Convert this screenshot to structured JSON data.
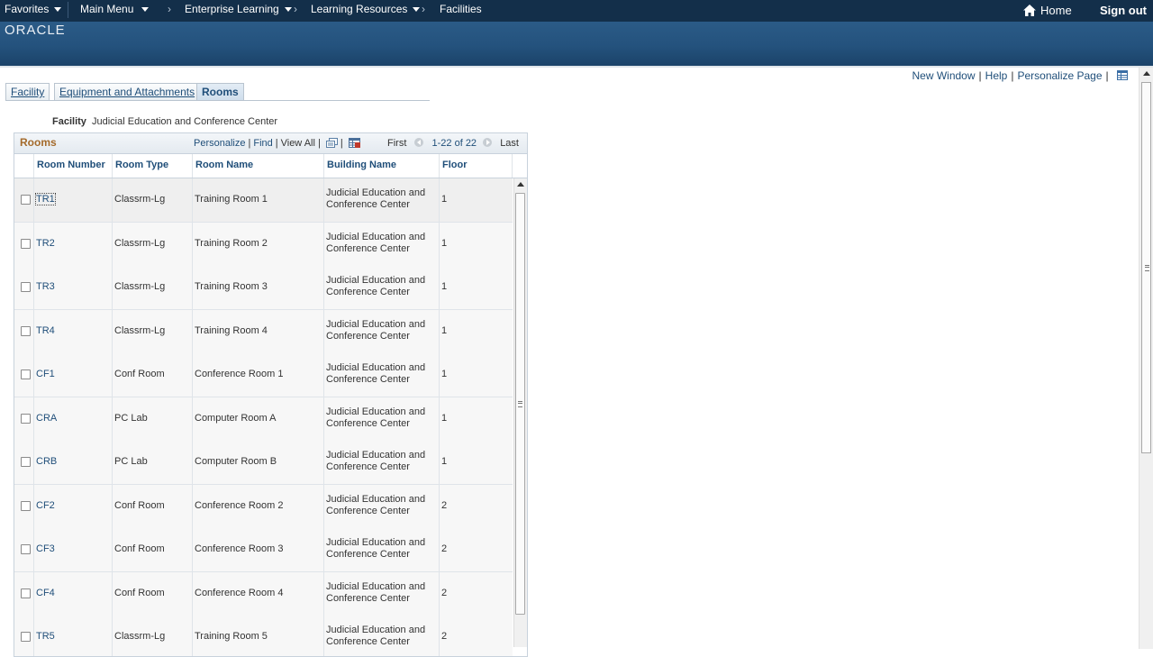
{
  "topnav": {
    "favorites": "Favorites",
    "main_menu": "Main Menu",
    "breadcrumbs": [
      "Enterprise Learning",
      "Learning Resources",
      "Facilities"
    ],
    "home": "Home",
    "sign_out": "Sign out"
  },
  "banner": {
    "logo_text": "ORACLE"
  },
  "page_links": {
    "new_window": "New Window",
    "help": "Help",
    "personalize_page": "Personalize Page"
  },
  "tabs": [
    {
      "label": "Facility",
      "active": false
    },
    {
      "label": "Equipment and Attachments",
      "active": false
    },
    {
      "label": "Rooms",
      "active": true
    }
  ],
  "facility": {
    "label": "Facility",
    "value": "Judicial Education and Conference Center"
  },
  "grid": {
    "title": "Rooms",
    "tools": {
      "personalize": "Personalize",
      "find": "Find",
      "view_all": "View All"
    },
    "nav": {
      "first": "First",
      "range": "1-22 of 22",
      "last": "Last"
    },
    "columns": [
      "Room Number",
      "Room Type",
      "Room Name",
      "Building Name",
      "Floor"
    ],
    "rows": [
      {
        "number": "TR1",
        "type": "Classrm-Lg",
        "name": "Training Room 1",
        "building": "Judicial Education and Conference Center",
        "floor": "1"
      },
      {
        "number": "TR2",
        "type": "Classrm-Lg",
        "name": "Training Room 2",
        "building": "Judicial Education and Conference Center",
        "floor": "1"
      },
      {
        "number": "TR3",
        "type": "Classrm-Lg",
        "name": "Training Room 3",
        "building": "Judicial Education and Conference Center",
        "floor": "1"
      },
      {
        "number": "TR4",
        "type": "Classrm-Lg",
        "name": "Training Room 4",
        "building": "Judicial Education and Conference Center",
        "floor": "1"
      },
      {
        "number": "CF1",
        "type": "Conf Room",
        "name": "Conference Room 1",
        "building": "Judicial Education and Conference Center",
        "floor": "1"
      },
      {
        "number": "CRA",
        "type": "PC Lab",
        "name": "Computer Room A",
        "building": "Judicial Education and Conference Center",
        "floor": "1"
      },
      {
        "number": "CRB",
        "type": "PC Lab",
        "name": "Computer Room B",
        "building": "Judicial Education and Conference Center",
        "floor": "1"
      },
      {
        "number": "CF2",
        "type": "Conf Room",
        "name": "Conference Room 2",
        "building": "Judicial Education and Conference Center",
        "floor": "2"
      },
      {
        "number": "CF3",
        "type": "Conf Room",
        "name": "Conference Room 3",
        "building": "Judicial Education and Conference Center",
        "floor": "2"
      },
      {
        "number": "CF4",
        "type": "Conf Room",
        "name": "Conference Room 4",
        "building": "Judicial Education and Conference Center",
        "floor": "2"
      },
      {
        "number": "TR5",
        "type": "Classrm-Lg",
        "name": "Training Room 5",
        "building": "Judicial Education and Conference Center",
        "floor": "2"
      }
    ]
  }
}
